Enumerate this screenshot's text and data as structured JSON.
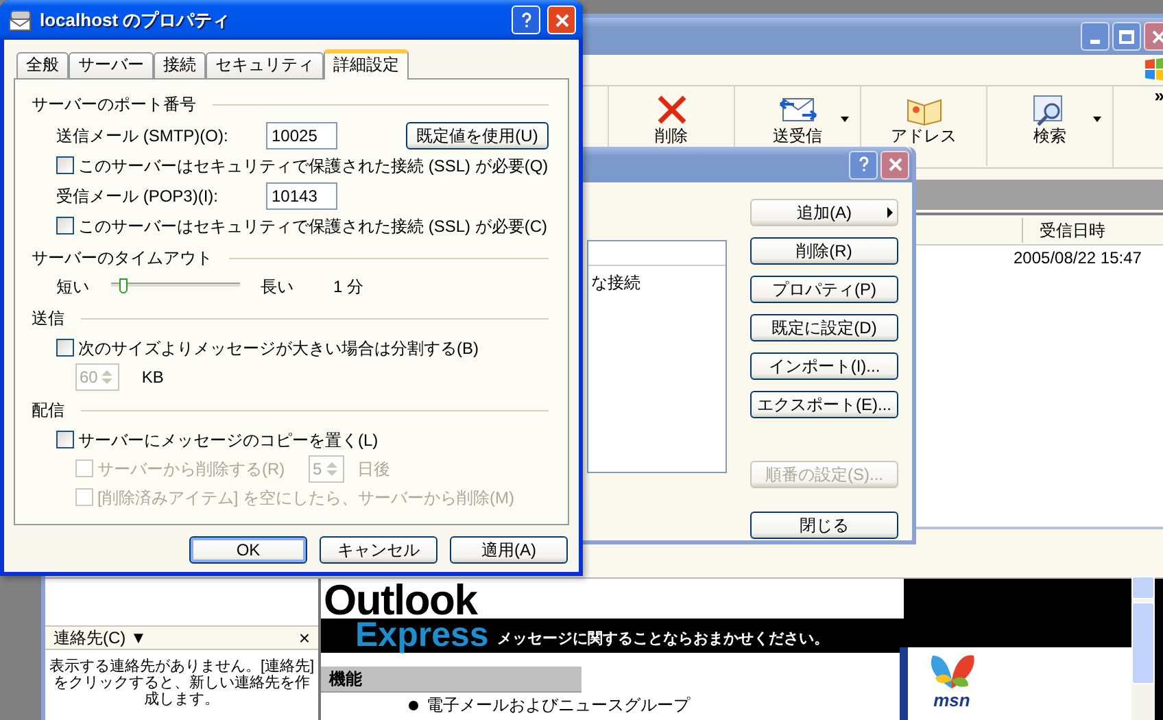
{
  "properties_dialog": {
    "title": "localhost のプロパティ",
    "tabs": [
      {
        "label": "全般",
        "selected": false
      },
      {
        "label": "サーバー",
        "selected": false
      },
      {
        "label": "接続",
        "selected": false
      },
      {
        "label": "セキュリティ",
        "selected": false
      },
      {
        "label": "詳細設定",
        "selected": true
      }
    ],
    "port_section": {
      "heading": "サーバーのポート番号",
      "smtp_label": "送信メール (SMTP)(O):",
      "smtp_value": "10025",
      "default_button": "既定値を使用(U)",
      "smtp_ssl": {
        "label": "このサーバーはセキュリティで保護された接続 (SSL) が必要(Q)",
        "checked": false
      },
      "pop3_label": "受信メール (POP3)(I):",
      "pop3_value": "10143",
      "pop3_ssl": {
        "label": "このサーバーはセキュリティで保護された接続 (SSL) が必要(C)",
        "checked": false
      }
    },
    "timeout_section": {
      "heading": "サーバーのタイムアウト",
      "short_label": "短い",
      "long_label": "長い",
      "level": 0.1,
      "reading": "1 分"
    },
    "sending_section": {
      "heading": "送信",
      "split": {
        "label": "次のサイズよりメッセージが大きい場合は分割する(B)",
        "checked": false
      },
      "size_value": "60",
      "size_disabled": true,
      "size_unit": "KB"
    },
    "delivery_section": {
      "heading": "配信",
      "leave_copy": {
        "label": "サーバーにメッセージのコピーを置く(L)",
        "checked": false,
        "disabled": false
      },
      "remove_after": {
        "label": "サーバーから削除する(R)",
        "checked": false,
        "disabled": true
      },
      "days_value": "5",
      "days_disabled": true,
      "days_unit": "日後",
      "remove_deleted": {
        "label": "[削除済みアイテム] を空にしたら、サーバーから削除(M)",
        "checked": false,
        "disabled": true
      }
    },
    "buttons": [
      {
        "label": "OK",
        "default": true
      },
      {
        "label": "キャンセル",
        "default": false
      },
      {
        "label": "適用(A)",
        "default": false
      }
    ]
  },
  "accounts_dialog": {
    "list_item": "な接続",
    "buttons": [
      {
        "label": "追加(A)",
        "kind": "menu",
        "disabled": false
      },
      {
        "label": "削除(R)",
        "kind": "push",
        "disabled": false
      },
      {
        "label": "プロパティ(P)",
        "kind": "push",
        "disabled": false
      },
      {
        "label": "既定に設定(D)",
        "kind": "push",
        "disabled": false
      },
      {
        "label": "インポート(I)...",
        "kind": "push",
        "disabled": false
      },
      {
        "label": "エクスポート(E)...",
        "kind": "push",
        "disabled": false
      },
      {
        "label": "順番の設定(S)...",
        "kind": "push",
        "disabled": true
      },
      {
        "label": "閉じる",
        "kind": "push",
        "disabled": false
      }
    ]
  },
  "main_window": {
    "toolbar": [
      {
        "label": "削除",
        "kind": "delete",
        "dropdown": false
      },
      {
        "label": "送受信",
        "kind": "send_receive",
        "dropdown": true
      },
      {
        "label": "アドレス",
        "kind": "addresses",
        "dropdown": false
      },
      {
        "label": "検索",
        "kind": "find",
        "dropdown": true
      }
    ],
    "toolbar_overflow": "»",
    "message_list": {
      "columns": [
        "受信日時"
      ],
      "rows": [
        [
          "2005/08/22 15:47"
        ]
      ]
    },
    "contacts_pane": {
      "title": "連絡先(C) ▼",
      "close": "×",
      "message": "表示する連絡先がありません。[連絡先] をクリックすると、新しい連絡先を作成します。"
    },
    "preview": {
      "logo_top": "Outlook",
      "logo_bottom": "Express",
      "tagline": "メッセージに関することならおまかせください。",
      "section_heading": "機能",
      "bullets": [
        "電子メールおよびニュースグループ"
      ],
      "msn_label": "msn"
    }
  }
}
